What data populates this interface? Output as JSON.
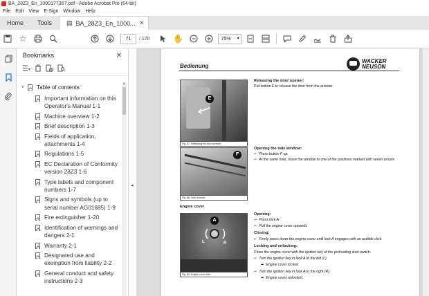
{
  "window": {
    "title": "BA_28Z3_En_1000177367.pdf - Adobe Acrobat Pro (64-bit)"
  },
  "menu": [
    "File",
    "Edit",
    "View",
    "E-Sign",
    "Window",
    "Help"
  ],
  "tabs": {
    "home": "Home",
    "tools": "Tools",
    "document": "BA_28Z3_En_1000...",
    "close": "✕"
  },
  "toolbar": {
    "page_current": "71",
    "page_total": "/ 170",
    "zoom": "75%",
    "zoom_caret": "▾"
  },
  "bookmarks": {
    "title": "Bookmarks",
    "close": "✕",
    "root": "Table of contents",
    "items": [
      "Important information on this Operator's Manual 1-1",
      "Machine overview 1-2",
      "Brief description 1-3",
      "Fields of application, attachments 1-4",
      "Regulations 1-5",
      "EC Declaration of Conformity version 28Z3 1-6",
      "Type labels and component numbers 1-7",
      "Signs and symbols (up to serial number AG01685) 1-9",
      "Fire extinguisher 1-20",
      "Identification of warnings and dangers 2-1",
      "Warranty 2-1",
      "Designated use and exemption from liability 2-2",
      "General conduct and safety instructions 2-3"
    ]
  },
  "pdf_page": {
    "header": "Bedienung",
    "logo_line1": "WACKER",
    "logo_line2": "NEUSON",
    "fig1": {
      "marker": "E",
      "caption": "Fig. 87:    Releasing the door arrester"
    },
    "fig2": {
      "marker": "F",
      "caption": "Fig. 88:    Side window"
    },
    "fig3": {
      "marker": "A",
      "label_left": "L",
      "label_right": "R",
      "caption": "Fig. 89:    Engine cover lock"
    },
    "door": {
      "heading": "Releasing the door opener:",
      "text": "Pull button E to release the door from the arrester."
    },
    "window": {
      "heading": "Opening the side window:",
      "step1": "Press button F up.",
      "step2": "At the same time, move the window to one of the positions marked with seven arrows"
    },
    "engine_cover_heading": "Engine cover",
    "opening": {
      "heading": "Opening:",
      "step1": "Press lock A",
      "step2": "Pull the engine cover upwards"
    },
    "closing": {
      "heading": "Closing:",
      "step1": "Firmly press down the engine cover until lock A engages with an audible click"
    },
    "locking": {
      "heading": "Locking and unlocking:",
      "text": "Close the engine cover with the ignition key of the preheating start switch.",
      "step1": "Turn the ignition key in lock A to the left (L)",
      "result1": "Engine cover locked",
      "step2": "Turn the ignition key in lock A to the right (R)",
      "result2": "Engine cover unlocked"
    },
    "step_glyph": "⇐",
    "result_glyph": "➡"
  }
}
